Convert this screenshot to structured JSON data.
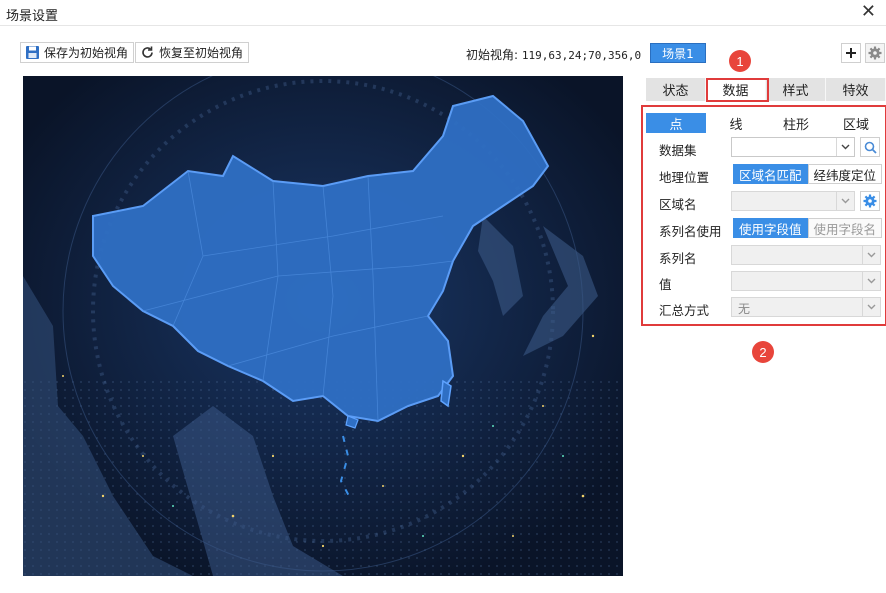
{
  "window": {
    "title": "场景设置"
  },
  "toolbar": {
    "save_label": "保存为初始视角",
    "restore_label": "恢复至初始视角",
    "view_label": "初始视角:",
    "view_value": "119,63,24;70,356,0",
    "scene_label": "场景1"
  },
  "annotations": {
    "marker1": "1",
    "marker2": "2"
  },
  "tabs": [
    {
      "label": "状态"
    },
    {
      "label": "数据"
    },
    {
      "label": "样式"
    },
    {
      "label": "特效"
    }
  ],
  "subtabs": [
    {
      "label": "点"
    },
    {
      "label": "线"
    },
    {
      "label": "柱形"
    },
    {
      "label": "区域"
    }
  ],
  "form": {
    "dataset_label": "数据集",
    "geo_label": "地理位置",
    "geo_option_1": "区域名匹配",
    "geo_option_2": "经纬度定位",
    "region_label": "区域名",
    "series_use_label": "系列名使用",
    "series_use_option_1": "使用字段值",
    "series_use_option_2": "使用字段名",
    "series_label": "系列名",
    "value_label": "值",
    "summary_label": "汇总方式",
    "summary_value": "无"
  },
  "colors": {
    "accent": "#3a8ee6",
    "highlight": "#e03b3b",
    "map_bg": "#0c1a33",
    "map_land": "#2f6fc4"
  }
}
